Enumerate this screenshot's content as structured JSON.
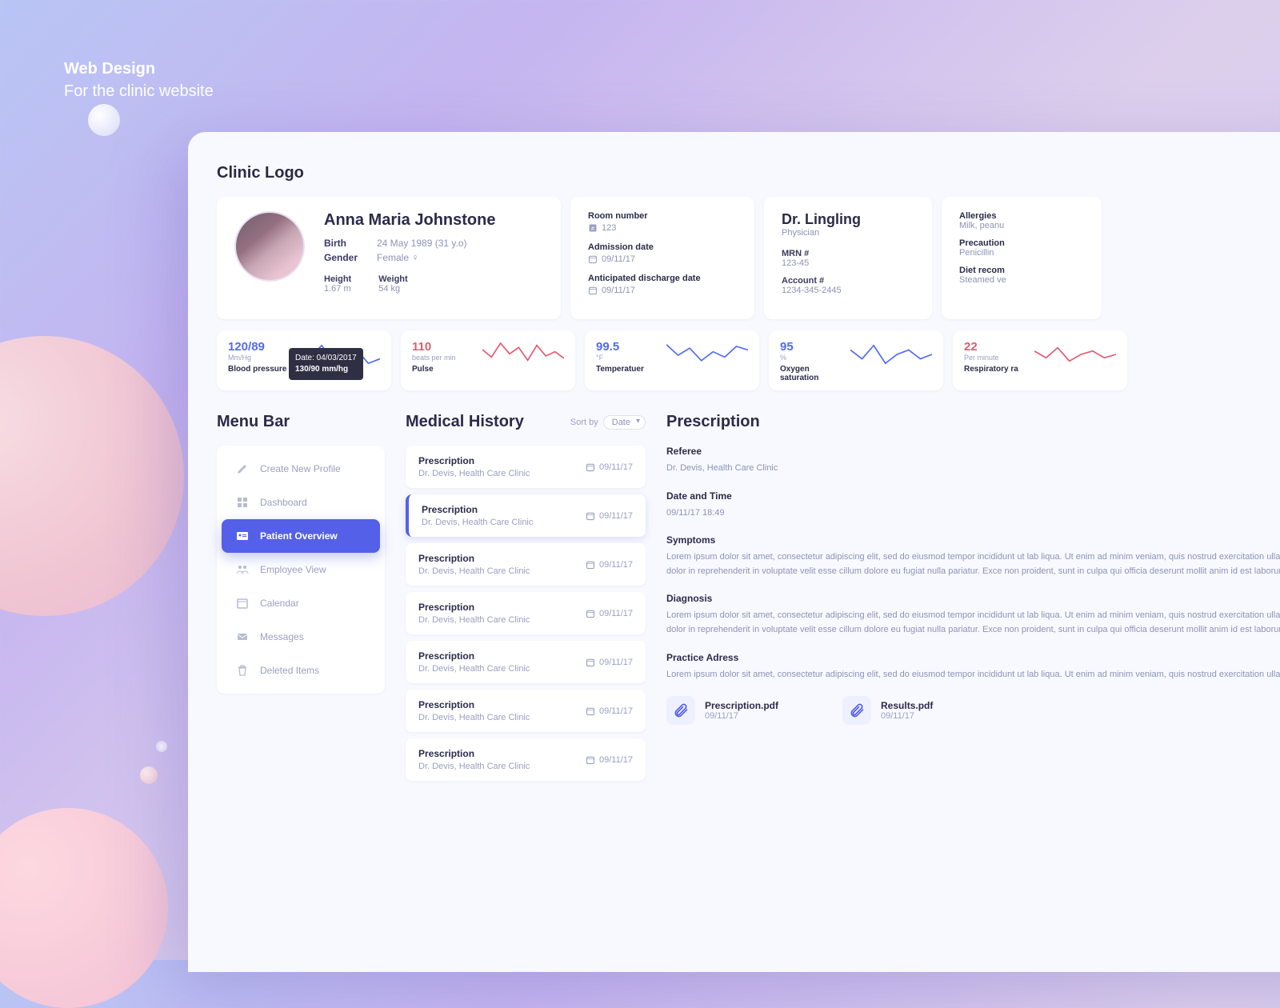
{
  "caption_line1": "Web Design",
  "caption_line2": "For the clinic website",
  "logo": "Clinic Logo",
  "patient": {
    "name": "Anna Maria Johnstone",
    "birth_label": "Birth",
    "birth": "24 May 1989 (31 y.o)",
    "gender_label": "Gender",
    "gender": "Female",
    "height_label": "Height",
    "height": "1.67 m",
    "weight_label": "Weight",
    "weight": "54 kg"
  },
  "admission": {
    "room_label": "Room number",
    "room": "123",
    "adm_label": "Admission date",
    "adm": "09/11/17",
    "dis_label": "Anticipated discharge date",
    "dis": "09/11/17"
  },
  "doctor": {
    "name": "Dr. Lingling",
    "role": "Physician",
    "mrn_label": "MRN #",
    "mrn": "123-45",
    "acct_label": "Account #",
    "acct": "1234-345-2445"
  },
  "medical_notes": {
    "allergies_label": "Allergies",
    "allergies": "Milk, peanu",
    "precautions_label": "Precaution",
    "precautions": "Penicillin",
    "diet_label": "Diet recom",
    "diet": "Steamed ve"
  },
  "vitals": [
    {
      "value": "120/89",
      "unit": "Mm/Hg",
      "name": "Blood pressure",
      "color": "blue",
      "tooltip_date": "Date: 04/03/2017",
      "tooltip_val": "130/90 mm/hg"
    },
    {
      "value": "110",
      "unit": "beats per min",
      "name": "Pulse",
      "color": "red"
    },
    {
      "value": "99.5",
      "unit": "°F",
      "name": "Temperatuer",
      "color": "blue"
    },
    {
      "value": "95",
      "unit": "%",
      "name": "Oxygen saturation",
      "color": "blue"
    },
    {
      "value": "22",
      "unit": "Per minute",
      "name": "Respiratory ra",
      "color": "red"
    }
  ],
  "menu": {
    "title": "Menu Bar",
    "items": [
      {
        "label": "Create New Profile",
        "icon": "pencil"
      },
      {
        "label": "Dashboard",
        "icon": "grid"
      },
      {
        "label": "Patient Overview",
        "icon": "id-card",
        "active": true
      },
      {
        "label": "Employee View",
        "icon": "people"
      },
      {
        "label": "Calendar",
        "icon": "calendar"
      },
      {
        "label": "Messages",
        "icon": "mail"
      },
      {
        "label": "Deleted Items",
        "icon": "trash"
      }
    ]
  },
  "history": {
    "title": "Medical History",
    "sortby_label": "Sort by",
    "sort_value": "Date",
    "items": [
      {
        "title": "Prescription",
        "sub": "Dr. Devis, Health Care Clinic",
        "date": "09/11/17"
      },
      {
        "title": "Prescription",
        "sub": "Dr. Devis, Health Care Clinic",
        "date": "09/11/17",
        "selected": true
      },
      {
        "title": "Prescription",
        "sub": "Dr. Devis, Health Care Clinic",
        "date": "09/11/17"
      },
      {
        "title": "Prescription",
        "sub": "Dr. Devis, Health Care Clinic",
        "date": "09/11/17"
      },
      {
        "title": "Prescription",
        "sub": "Dr. Devis, Health Care Clinic",
        "date": "09/11/17"
      },
      {
        "title": "Prescription",
        "sub": "Dr. Devis, Health Care Clinic",
        "date": "09/11/17"
      },
      {
        "title": "Prescription",
        "sub": "Dr. Devis, Health Care Clinic",
        "date": "09/11/17"
      }
    ]
  },
  "prescription": {
    "title": "Prescription",
    "referee_label": "Referee",
    "referee": "Dr. Devis, Health Care Clinic",
    "datetime_label": "Date and Time",
    "datetime": "09/11/17 18:49",
    "symptoms_label": "Symptoms",
    "symptoms": "Lorem ipsum dolor sit amet, consectetur adipiscing elit, sed do eiusmod tempor incididunt ut lab liqua. Ut enim ad minim veniam, quis nostrud exercitation ullamco laboris nisi ut aliquip ex ea con aute irure dolor in reprehenderit in voluptate velit esse cillum dolore eu fugiat nulla pariatur. Exce non proident, sunt in culpa qui officia deserunt mollit anim id est laborum.",
    "diagnosis_label": "Diagnosis",
    "diagnosis": "Lorem ipsum dolor sit amet, consectetur adipiscing elit, sed do eiusmod tempor incididunt ut lab liqua. Ut enim ad minim veniam, quis nostrud exercitation ullamco laboris nisi ut aliquip ex ea con aute irure dolor in reprehenderit in voluptate velit esse cillum dolore eu fugiat nulla pariatur. Exce non proident, sunt in culpa qui officia deserunt mollit anim id est laborum.",
    "address_label": "Practice Adress",
    "address": "Lorem ipsum dolor sit amet, consectetur adipiscing elit, sed do eiusmod tempor incididunt ut lab liqua. Ut enim ad minim veniam, quis nostrud exercitation ullamco laboris nisi ut aliquip ex ea con",
    "attachments": [
      {
        "name": "Prescription.pdf",
        "date": "09/11/17"
      },
      {
        "name": "Results.pdf",
        "date": "09/11/17"
      }
    ]
  },
  "chart_data": [
    {
      "type": "line",
      "name": "Blood pressure",
      "unit": "mm/Hg",
      "x": [
        1,
        2,
        3,
        4,
        5,
        6,
        7,
        8
      ],
      "values": [
        128,
        122,
        135,
        118,
        124,
        130,
        115,
        120
      ],
      "ylim": [
        110,
        140
      ]
    },
    {
      "type": "line",
      "name": "Pulse",
      "unit": "bpm",
      "x": [
        1,
        2,
        3,
        4,
        5,
        6,
        7,
        8,
        9,
        10
      ],
      "values": [
        112,
        105,
        118,
        108,
        114,
        102,
        116,
        106,
        110,
        104
      ],
      "ylim": [
        95,
        120
      ]
    },
    {
      "type": "line",
      "name": "Temperature",
      "unit": "°F",
      "x": [
        1,
        2,
        3,
        4,
        5,
        6,
        7,
        8
      ],
      "values": [
        99.8,
        99.2,
        99.6,
        98.9,
        99.4,
        99.1,
        99.7,
        99.5
      ],
      "ylim": [
        98.5,
        100
      ]
    },
    {
      "type": "line",
      "name": "Oxygen saturation",
      "unit": "%",
      "x": [
        1,
        2,
        3,
        4,
        5,
        6,
        7,
        8
      ],
      "values": [
        96,
        94,
        97,
        93,
        95,
        96,
        94,
        95
      ],
      "ylim": [
        92,
        98
      ]
    },
    {
      "type": "line",
      "name": "Respiratory rate",
      "unit": "per min",
      "x": [
        1,
        2,
        3,
        4,
        5,
        6,
        7,
        8
      ],
      "values": [
        23,
        21,
        24,
        20,
        22,
        23,
        21,
        22
      ],
      "ylim": [
        18,
        26
      ]
    }
  ]
}
